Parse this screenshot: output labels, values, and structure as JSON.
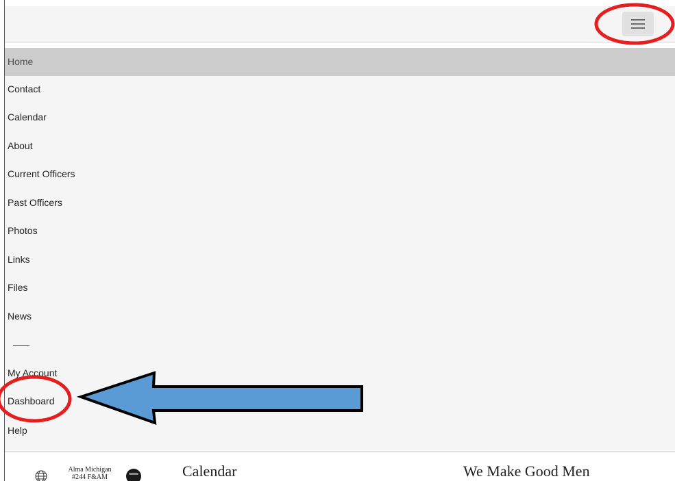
{
  "header": {
    "menu_toggle_icon": "hamburger-menu-icon"
  },
  "menu": {
    "items": [
      {
        "label": "Home",
        "active": true
      },
      {
        "label": "Contact"
      },
      {
        "label": "Calendar"
      },
      {
        "label": "About"
      },
      {
        "label": "Current Officers"
      },
      {
        "label": "Past Officers"
      },
      {
        "label": "Photos"
      },
      {
        "label": "Links"
      },
      {
        "label": "Files"
      },
      {
        "label": "News"
      },
      {
        "label": "My Account"
      },
      {
        "label": "Dashboard"
      },
      {
        "label": "Help"
      }
    ]
  },
  "footer": {
    "lodge_line_1": "Alma Michigan",
    "lodge_line_2": "#244 F&AM",
    "title": "Calendar",
    "tagline": "We Make Good Men"
  },
  "annotation_colors": {
    "circle": "#e51f1f",
    "arrow_fill": "#5b9bd5",
    "arrow_stroke": "#000000"
  }
}
